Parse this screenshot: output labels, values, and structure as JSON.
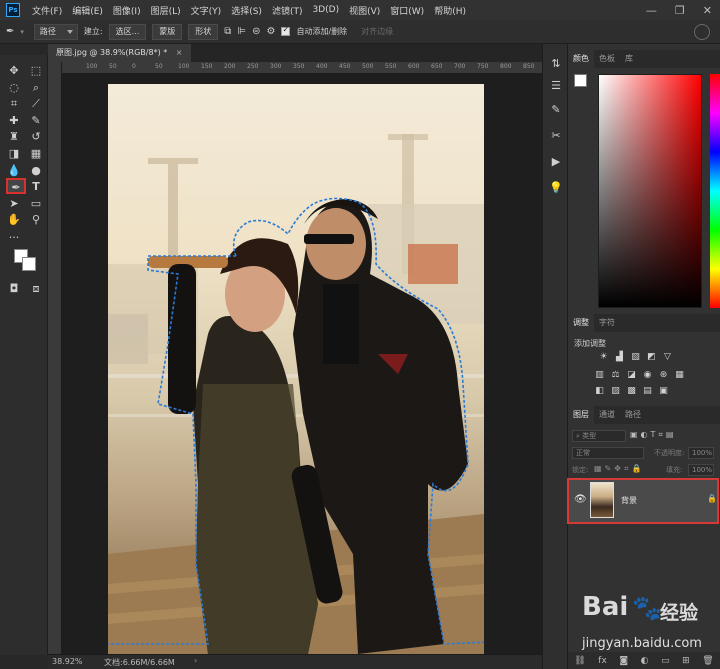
{
  "menu": {
    "logo": "Ps",
    "items": [
      "文件(F)",
      "编辑(E)",
      "图像(I)",
      "图层(L)",
      "文字(Y)",
      "选择(S)",
      "滤镜(T)",
      "3D(D)",
      "视图(V)",
      "窗口(W)",
      "帮助(H)"
    ],
    "window_buttons": [
      "—",
      "❐",
      "✕"
    ]
  },
  "options": {
    "mode": "路径",
    "build_label": "建立:",
    "selection_btn": "选区...",
    "mask_btn": "蒙版",
    "shape_btn": "形状",
    "auto_add_label": "自动添加/删除",
    "align_edges_label": "对齐边缘"
  },
  "document": {
    "tab_title": "原图.jpg @ 38.9%(RGB/8*) *",
    "zoom_status": "38.92%",
    "doc_status": "文档:6.66M/6.66M",
    "ruler_labels": [
      "100",
      "50",
      "0",
      "50",
      "100",
      "150",
      "200",
      "250",
      "300",
      "350",
      "400",
      "450",
      "500",
      "550",
      "600",
      "650",
      "700",
      "750",
      "800",
      "850"
    ]
  },
  "panels": {
    "color_tabs": [
      "颜色",
      "色板",
      "库"
    ],
    "adjust_tabs": [
      "调整",
      "字符"
    ],
    "adjust_title": "添加调整",
    "layer_tabs": [
      "图层",
      "通道",
      "路径"
    ],
    "layer_filter": "类型",
    "blend_mode": "正常",
    "opacity_label": "不透明度:",
    "opacity_value": "100%",
    "lock_label": "锁定:",
    "fill_label": "填充:",
    "fill_value": "100%",
    "layer_name": "背景"
  },
  "watermark": {
    "brand": "Bai",
    "brand2": "经验",
    "url": "jingyan.baidu.com"
  },
  "colors": {
    "accent_red": "#d63a34",
    "path_blue": "#2b7bd6",
    "fg_color": "#ffffff",
    "bg_color": "#ffffff"
  }
}
